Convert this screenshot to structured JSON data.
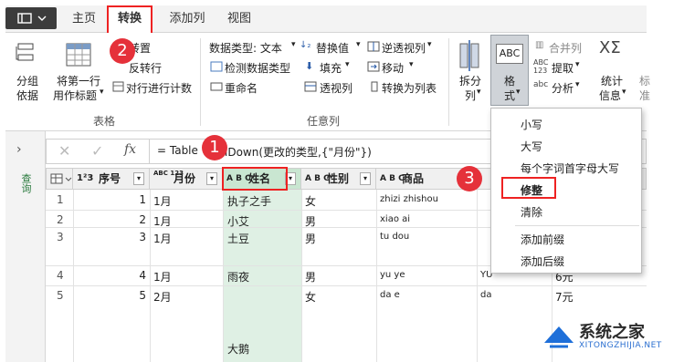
{
  "tabs": {
    "home": "主页",
    "transform": "转换",
    "add_column": "添加列",
    "view": "视图"
  },
  "ribbon": {
    "group_by_line1": "分组",
    "group_by_line2": "依据",
    "use_first_row_line1": "将第一行",
    "use_first_row_line2": "用作标题",
    "transpose": "转置",
    "reverse_rows": "反转行",
    "count_rows": "对行进行计数",
    "table_group": "表格",
    "data_type": "数据类型: 文本",
    "detect_type": "检测数据类型",
    "rename": "重命名",
    "replace_values": "替换值",
    "fill": "填充",
    "pivot_column": "透视列",
    "unpivot": "逆透视列",
    "move": "移动",
    "to_list": "转换为列表",
    "any_column_group": "任意列",
    "split_line1": "拆分",
    "split_line2": "列",
    "format_line1": "格",
    "format_line2": "式",
    "merge_columns": "合并列",
    "extract": "提取",
    "parse": "分析",
    "statistics_line1": "统计",
    "statistics_line2": "信息",
    "standard_partial": "标",
    "standard_partial2": "准"
  },
  "sidebar": {
    "label": "查询"
  },
  "formula": {
    "text": "= Table.FillDown(更改的类型,{\"月份\"})",
    "visible_prefix": "= Table",
    "visible_suffix": "lDown(更改的类型,{\"月份\"})"
  },
  "columns": [
    {
      "type": "1²3",
      "name": "序号"
    },
    {
      "type": "ABC 123",
      "name": "月份"
    },
    {
      "type": "A B C",
      "name": "姓名"
    },
    {
      "type": "A B C",
      "name": "性别"
    },
    {
      "type": "A B C",
      "name": "商品"
    },
    {
      "type": "",
      "name": ""
    },
    {
      "type": "",
      "name": ""
    }
  ],
  "rows": [
    {
      "num": "1",
      "seq": "1",
      "month": "1月",
      "name": "执子之手",
      "gender": "女",
      "product": "zhizi  zhishou",
      "col6": "",
      "col7": ""
    },
    {
      "num": "2",
      "seq": "2",
      "month": "1月",
      "name": "小艾",
      "gender": "男",
      "product": "xiao  ai",
      "col6": "",
      "col7": ""
    },
    {
      "num": "3",
      "seq": "3",
      "month": "1月",
      "name": "土豆",
      "gender": "男",
      "product": "tu dou",
      "col6": "",
      "col7": ""
    },
    {
      "num": "4",
      "seq": "4",
      "month": "1月",
      "name": "雨夜",
      "gender": "男",
      "product": "yu ye",
      "col6": "YU",
      "col7": "6元"
    },
    {
      "num": "5",
      "seq": "5",
      "month": "2月",
      "name": "大鹅",
      "gender": "女",
      "product": "da e",
      "col6": "da",
      "col7": "7元"
    }
  ],
  "format_menu": {
    "items": [
      "小写",
      "大写",
      "每个字词首字母大写",
      "修整",
      "清除",
      "添加前缀",
      "添加后缀"
    ]
  },
  "badges": [
    "1",
    "2",
    "3"
  ],
  "watermark": {
    "line1": "系统之家",
    "line2": "XITONGZHIJIA.NET"
  },
  "colors": {
    "accent": "#e22222",
    "selected_column": "#dff0e4",
    "badge": "#e5313a"
  }
}
